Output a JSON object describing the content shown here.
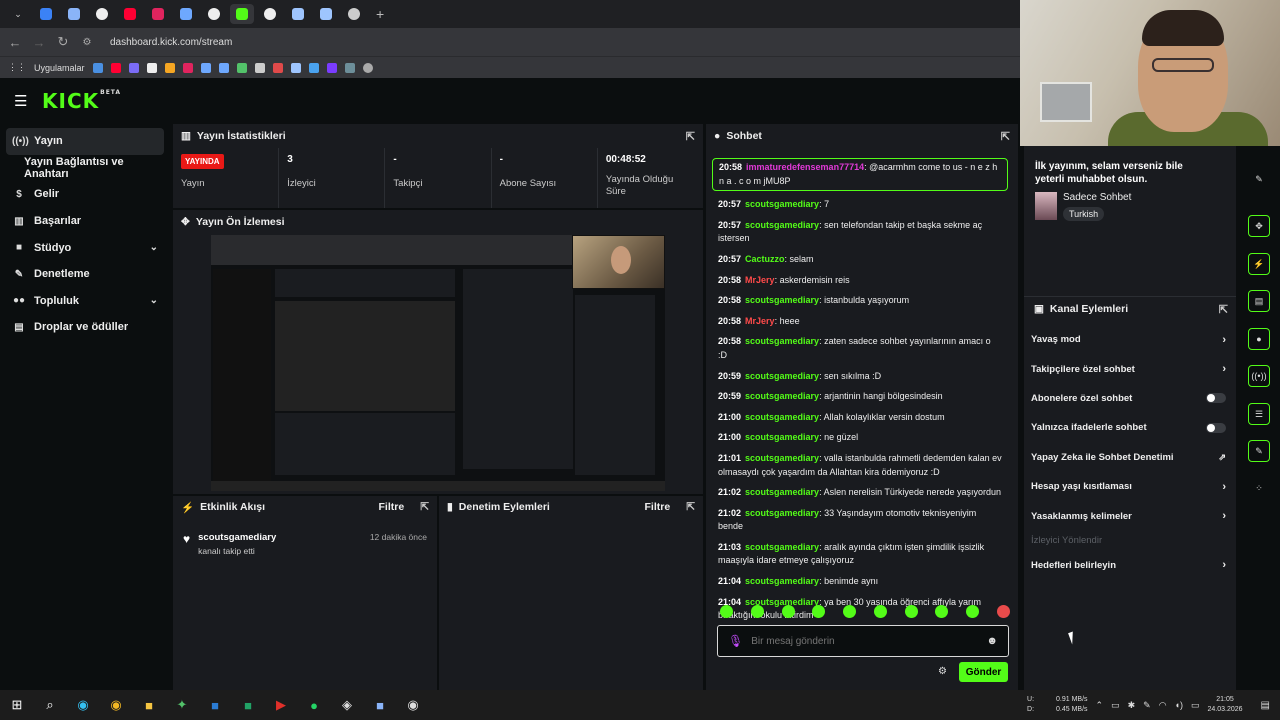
{
  "browser": {
    "url": "dashboard.kick.com/stream",
    "bookmarks_label": "Uygulamalar",
    "new_tab": "+"
  },
  "header": {
    "logo": "KICK",
    "beta": "BETA"
  },
  "sidebar": {
    "items": [
      {
        "label": "Yayın"
      },
      {
        "label": "Yayın Bağlantısı ve Anahtarı"
      },
      {
        "label": "Gelir"
      },
      {
        "label": "Başarılar"
      },
      {
        "label": "Stüdyo"
      },
      {
        "label": "Denetleme"
      },
      {
        "label": "Topluluk"
      },
      {
        "label": "Droplar ve ödüller"
      }
    ]
  },
  "stats_panel": {
    "title": "Yayın İstatistikleri",
    "live_badge": "YAYINDA",
    "live_label": "Yayın",
    "viewers_value": "3",
    "viewers_label": "İzleyici",
    "followers_value": "-",
    "followers_label": "Takipçi",
    "subs_value": "-",
    "subs_label": "Abone Sayısı",
    "duration_value": "00:48:52",
    "duration_label": "Yayında Olduğu Süre"
  },
  "preview_panel": {
    "title": "Yayın Ön İzlemesi"
  },
  "activity_panel": {
    "title": "Etkinlik Akışı",
    "filter": "Filtre",
    "event_user": "scoutsgamediary",
    "event_text": "kanalı takip etti",
    "event_time": "12 dakika önce"
  },
  "mod_panel": {
    "title": "Denetim Eylemleri",
    "filter": "Filtre"
  },
  "chat": {
    "title": "Sohbet",
    "messages": [
      {
        "time": "20:58",
        "user": "immaturedefenseman77714",
        "text": ": @acarmhm come to us - n e z h n a . c o m jMU8P"
      },
      {
        "time": "20:57",
        "user": "scoutsgamediary",
        "text": ": 7"
      },
      {
        "time": "20:57",
        "user": "scoutsgamediary",
        "text": ": sen telefondan takip et başka sekme aç istersen"
      },
      {
        "time": "20:57",
        "user": "Cactuzzo",
        "text": ": selam"
      },
      {
        "time": "20:58",
        "user": "MrJery",
        "text": ": askerdemisin reis"
      },
      {
        "time": "20:58",
        "user": "scoutsgamediary",
        "text": ": istanbulda yaşıyorum"
      },
      {
        "time": "20:58",
        "user": "MrJery",
        "text": ": heee"
      },
      {
        "time": "20:58",
        "user": "scoutsgamediary",
        "text": ": zaten sadece sohbet yayınlarının amacı o :D"
      },
      {
        "time": "20:59",
        "user": "scoutsgamediary",
        "text": ": sen sıkılma :D"
      },
      {
        "time": "20:59",
        "user": "scoutsgamediary",
        "text": ": arjantinin hangi bölgesindesin"
      },
      {
        "time": "21:00",
        "user": "scoutsgamediary",
        "text": ": Allah kolaylıklar versin dostum"
      },
      {
        "time": "21:00",
        "user": "scoutsgamediary",
        "text": ": ne güzel"
      },
      {
        "time": "21:01",
        "user": "scoutsgamediary",
        "text": ": valla istanbulda rahmetli dedemden kalan ev olmasaydı çok yaşardım da Allahtan kira ödemiyoruz :D"
      },
      {
        "time": "21:02",
        "user": "scoutsgamediary",
        "text": ": Aslen nerelisin Türkiyede nerede yaşıyordun"
      },
      {
        "time": "21:02",
        "user": "scoutsgamediary",
        "text": ": 33 Yaşındayım otomotiv teknisyeniyim bende"
      },
      {
        "time": "21:03",
        "user": "scoutsgamediary",
        "text": ": aralık ayında çıktım işten şimdilik işsizlik maaşıyla idare etmeye çalışıyoruz"
      },
      {
        "time": "21:04",
        "user": "scoutsgamediary",
        "text": ": benimde aynı"
      },
      {
        "time": "21:04",
        "user": "scoutsgamediary",
        "text": ": ya ben 30 yaşında öğrenci affıyla yarım bıraktığım okulu bitirdim"
      }
    ],
    "input_placeholder": "Bir mesaj gönderin",
    "send_label": "Gönder"
  },
  "stream_info": {
    "title": "İlk yayınım, selam verseniz bile yeterli muhabbet olsun.",
    "category": "Sadece Sohbet",
    "language_tag": "Turkish"
  },
  "channel_actions": {
    "title": "Kanal Eylemleri",
    "items": [
      {
        "label": "Yavaş mod"
      },
      {
        "label": "Takipçilere özel sohbet"
      },
      {
        "label": "Abonelere özel sohbet"
      },
      {
        "label": "Yalnızca ifadelerle sohbet"
      },
      {
        "label": "Yapay Zeka ile Sohbet Denetimi"
      },
      {
        "label": "Hesap yaşı kısıtlaması"
      },
      {
        "label": "Yasaklanmış kelimeler"
      },
      {
        "label": "İzleyici Yönlendir"
      },
      {
        "label": "Hedefleri belirleyin"
      }
    ]
  },
  "taskbar": {
    "net_up_label": "U:",
    "net_down_label": "D:",
    "net_up": "0.91 MB/s",
    "net_down": "0.45 MB/s",
    "time": "21:05",
    "date": "24.03.2026"
  },
  "colors": {
    "accent": "#53fc18",
    "live": "#e91916",
    "panel": "#191b1f",
    "bg": "#0b0e0f"
  }
}
